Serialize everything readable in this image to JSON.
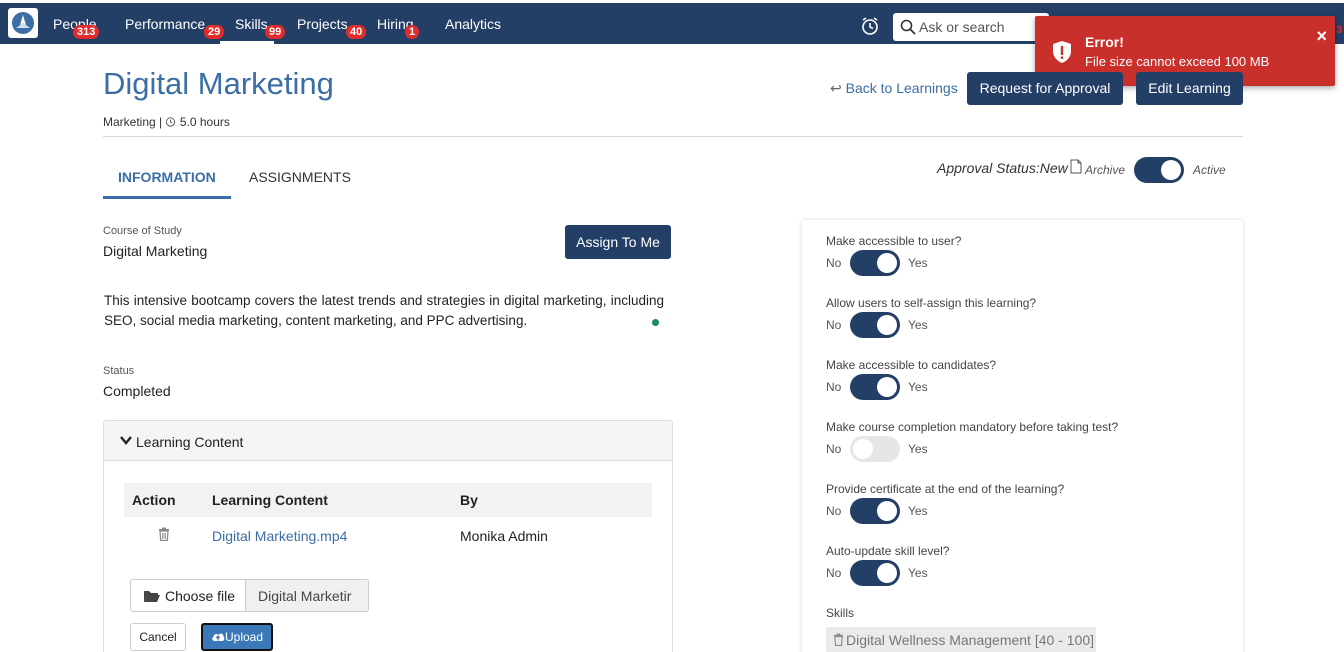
{
  "nav": {
    "items": [
      {
        "label": "People",
        "badge": "313"
      },
      {
        "label": "Performance",
        "badge": "29"
      },
      {
        "label": "Skills",
        "badge": "99"
      },
      {
        "label": "Projects",
        "badge": "40"
      },
      {
        "label": "Hiring",
        "badge": "1"
      },
      {
        "label": "Analytics",
        "badge": ""
      }
    ],
    "search_placeholder": "Ask or search",
    "partial_badge": "3"
  },
  "toast": {
    "title": "Error!",
    "message": "File size cannot exceed 100 MB",
    "close": "×"
  },
  "header": {
    "title": "Digital Marketing",
    "meta_category": "Marketing",
    "meta_duration": "5.0 hours",
    "back_label": "Back to Learnings",
    "request_label": "Request for Approval",
    "edit_label": "Edit Learning"
  },
  "tabs": {
    "information": "INFORMATION",
    "assignments": "ASSIGNMENTS"
  },
  "approval": {
    "status_text": "Approval Status:New",
    "archive_label": "Archive",
    "active_label": "Active",
    "active_on": true
  },
  "info": {
    "course_label": "Course of Study",
    "course_value": "Digital Marketing",
    "assign_label": "Assign To Me",
    "description": "This intensive bootcamp covers the latest trends and strategies in digital marketing, including SEO, social media marketing, content marketing, and PPC advertising.",
    "status_label": "Status",
    "status_value": "Completed"
  },
  "learning_content": {
    "title": "Learning Content",
    "columns": [
      "Action",
      "Learning Content",
      "By"
    ],
    "rows": [
      {
        "content": "Digital Marketing.mp4",
        "by": "Monika Admin"
      }
    ],
    "choose_label": "Choose file",
    "file_name": "Digital Marketir",
    "cancel_label": "Cancel",
    "upload_label": "Upload"
  },
  "settings": {
    "no_label": "No",
    "yes_label": "Yes",
    "questions": [
      {
        "label": "Make accessible to user?",
        "on": true
      },
      {
        "label": "Allow users to self-assign this learning?",
        "on": true
      },
      {
        "label": "Make accessible to candidates?",
        "on": true
      },
      {
        "label": "Make course completion mandatory before taking test?",
        "on": false
      },
      {
        "label": "Provide certificate at the end of the learning?",
        "on": true
      },
      {
        "label": "Auto-update skill level?",
        "on": true
      }
    ],
    "skills_label": "Skills",
    "skills": [
      {
        "name": "Digital Wellness Management",
        "range": "[40 - 100]"
      }
    ]
  },
  "colors": {
    "navbar": "#243f66",
    "accent": "#3a6ea5",
    "error": "#c9302c"
  }
}
